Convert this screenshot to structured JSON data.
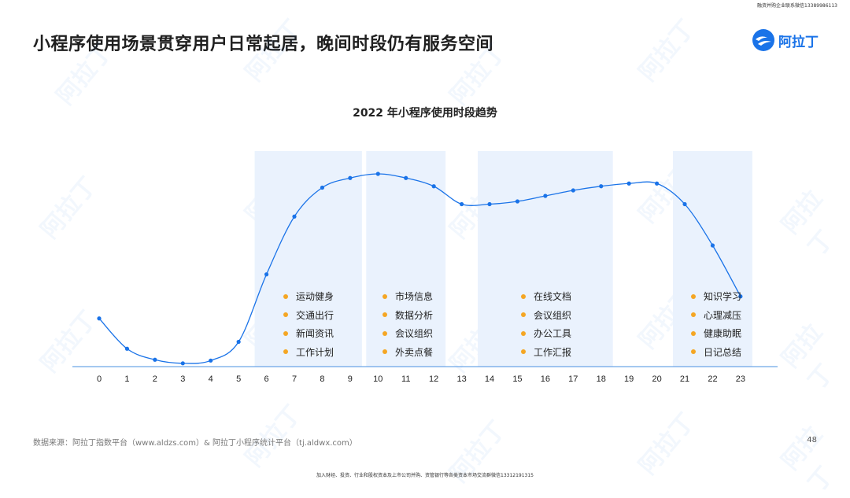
{
  "top_note": "融资并购企业联系微信13389986113",
  "title": "小程序使用场景贯穿用户日常起居，晚间时段仍有服务空间",
  "logo_text": "阿拉丁",
  "watermark_text": "阿拉丁",
  "chart_data": {
    "type": "line",
    "title": "2022 年小程序使用时段趋势",
    "x": [
      0,
      1,
      2,
      3,
      4,
      5,
      6,
      7,
      8,
      9,
      10,
      11,
      12,
      13,
      14,
      15,
      16,
      17,
      18,
      19,
      20,
      21,
      22,
      23
    ],
    "series": [
      {
        "values": [
          17.5,
          6.5,
          2.5,
          1.2,
          2.2,
          9.0,
          33.5,
          54.5,
          65.0,
          68.5,
          70.0,
          68.5,
          65.5,
          59.0,
          59.0,
          60.0,
          62.0,
          64.0,
          65.5,
          66.5,
          66.5,
          59.0,
          44.0,
          25.5
        ]
      }
    ],
    "ylim": [
      0,
      80
    ],
    "highlight_bands": [
      {
        "from": 6,
        "to": 9
      },
      {
        "from": 10,
        "to": 12
      },
      {
        "from": 14,
        "to": 18
      },
      {
        "from": 21,
        "to": 23
      }
    ],
    "line_color": "#1a73e8",
    "band_color": "#eaf2fd",
    "grid": false
  },
  "activity_groups": [
    {
      "items": [
        "运动健身",
        "交通出行",
        "新闻资讯",
        "工作计划"
      ]
    },
    {
      "items": [
        "市场信息",
        "数据分析",
        "会议组织",
        "外卖点餐"
      ]
    },
    {
      "items": [
        "在线文档",
        "会议组织",
        "办公工具",
        "工作汇报"
      ]
    },
    {
      "items": [
        "知识学习",
        "心理减压",
        "健康助眠",
        "日记总结"
      ]
    }
  ],
  "bullet_color": "#f5a623",
  "source": "数据来源：阿拉丁指数平台（www.aldzs.com）& 阿拉丁小程序统计平台（tj.aldwx.com）",
  "page_number": "48",
  "bottom_note": "加入财经、投资、行业和股权资本及上市公司并购、资管银行等各类资本市场交流群微信13312191315"
}
